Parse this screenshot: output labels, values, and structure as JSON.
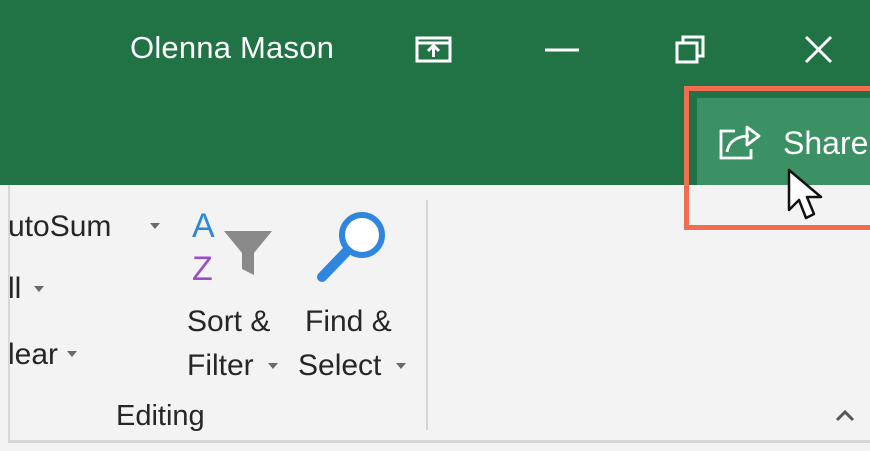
{
  "titlebar": {
    "user_name": "Olenna Mason",
    "icons": [
      "ribbon-display-options-icon",
      "minimize-icon",
      "restore-icon",
      "close-icon"
    ],
    "color": "#217346"
  },
  "share": {
    "label": "Share",
    "icon": "share-icon",
    "color": "#3c9164",
    "highlight_color": "#f26c4f"
  },
  "ribbon": {
    "editing": {
      "autosum_label": "utoSum",
      "fill_label": "ll",
      "clear_label": "lear",
      "sort_filter": {
        "line1": "Sort &",
        "line2": "Filter"
      },
      "find_select": {
        "line1": "Find &",
        "line2": "Select"
      },
      "group_label": "Editing"
    }
  }
}
